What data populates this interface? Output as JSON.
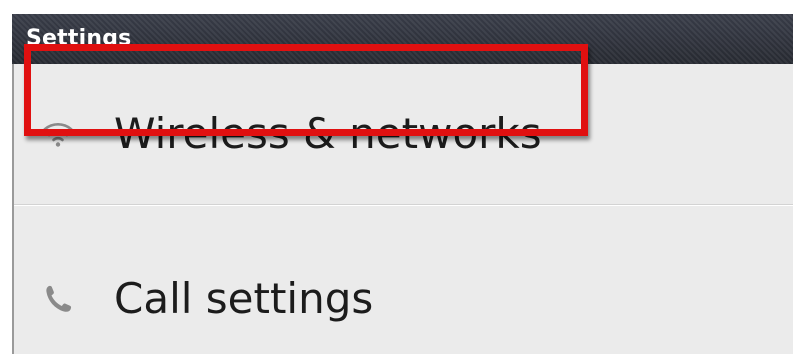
{
  "titlebar": {
    "title": "Settings"
  },
  "settings_list": {
    "items": [
      {
        "label": "Wireless & networks",
        "icon": "wifi-icon",
        "highlighted": true
      },
      {
        "label": "Call settings",
        "icon": "phone-icon",
        "highlighted": false
      }
    ]
  },
  "colors": {
    "titlebar_bg": "#2f323b",
    "list_bg": "#ebebeb",
    "highlight": "#e01010",
    "text": "#1c1c1c",
    "icon": "#8a8a8a"
  }
}
